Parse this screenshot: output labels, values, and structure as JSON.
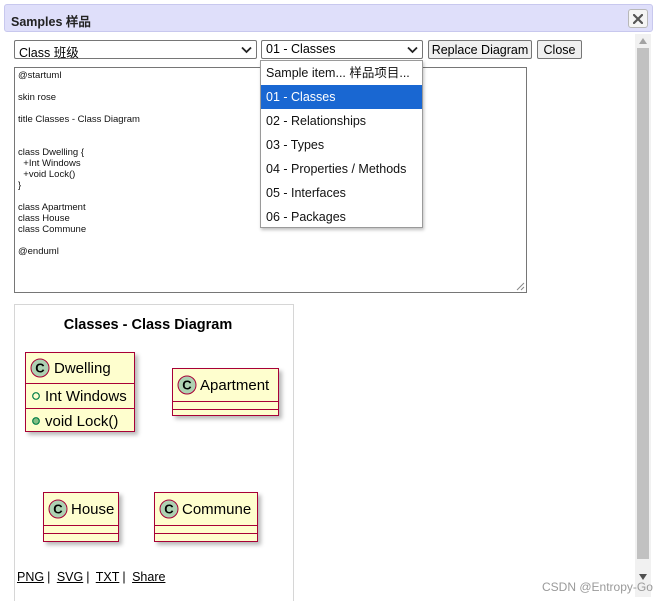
{
  "window": {
    "title": "Samples 样品"
  },
  "toolbar": {
    "category_select": "Class 班级",
    "sample_select": "01 - Classes",
    "replace_label": "Replace Diagram",
    "close_label": "Close"
  },
  "dropdown": {
    "options": [
      "Sample item... 样品项目...",
      "01 - Classes",
      "02 - Relationships",
      "03 - Types",
      "04 - Properties / Methods",
      "05 - Interfaces",
      "06 - Packages"
    ],
    "selected_index": 1
  },
  "editor": {
    "lines": [
      "@startuml",
      "",
      "skin rose",
      "",
      "title Classes - Class Diagram",
      "",
      "",
      "class Dwelling {",
      "  +Int Windows",
      "  +void Lock()",
      "}",
      "",
      "class Apartment",
      "class House",
      "class Commune",
      "",
      "@enduml"
    ]
  },
  "diagram": {
    "title": "Classes - Class Diagram",
    "classes": {
      "dwelling": {
        "name": "Dwelling",
        "members": [
          "Int Windows",
          "void Lock()"
        ]
      },
      "apartment": {
        "name": "Apartment"
      },
      "house": {
        "name": "House"
      },
      "commune": {
        "name": "Commune"
      }
    },
    "class_marker": "C",
    "colors": {
      "class_fill": "#fefece",
      "class_border": "#a80036",
      "marker_fill": "#add1b2"
    }
  },
  "links": {
    "png": "PNG",
    "svg": "SVG",
    "txt": "TXT",
    "share": "Share"
  },
  "watermark": "CSDN @Entropy-Go",
  "colors": {
    "titlebar": "#dfdffa",
    "selected_option": "#1967d2"
  }
}
